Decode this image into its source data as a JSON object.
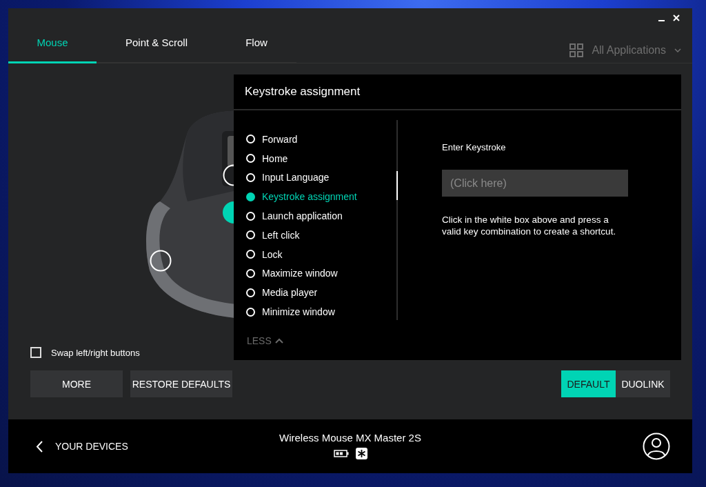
{
  "tabs": [
    {
      "label": "Mouse",
      "selected": true
    },
    {
      "label": "Point & Scroll",
      "selected": false
    },
    {
      "label": "Flow",
      "selected": false
    }
  ],
  "app_selector": {
    "label": "All Applications"
  },
  "hotspots": [
    {
      "selected": false
    },
    {
      "selected": true
    },
    {
      "selected": false
    }
  ],
  "panel": {
    "title": "Keystroke assignment",
    "options": [
      {
        "label": "Forward",
        "selected": false
      },
      {
        "label": "Home",
        "selected": false
      },
      {
        "label": "Input Language",
        "selected": false
      },
      {
        "label": "Keystroke assignment",
        "selected": true
      },
      {
        "label": "Launch application",
        "selected": false
      },
      {
        "label": "Left click",
        "selected": false
      },
      {
        "label": "Lock",
        "selected": false
      },
      {
        "label": "Maximize window",
        "selected": false
      },
      {
        "label": "Media player",
        "selected": false
      },
      {
        "label": "Minimize window",
        "selected": false
      }
    ],
    "less_label": "LESS",
    "keystroke_label": "Enter Keystroke",
    "keystroke_placeholder": "(Click here)",
    "help": "Click in the white box above and press a valid key combination to create a shortcut."
  },
  "swap_buttons": {
    "label": "Swap left/right buttons",
    "checked": false
  },
  "buttons": [
    "MORE",
    "RESTORE DEFAULTS"
  ],
  "mode_buttons": [
    {
      "label": "DEFAULT",
      "selected": true
    },
    {
      "label": "DUOLINK",
      "selected": false
    }
  ],
  "footer": {
    "back_label": "YOUR DEVICES",
    "device_name": "Wireless Mouse MX Master 2S"
  }
}
